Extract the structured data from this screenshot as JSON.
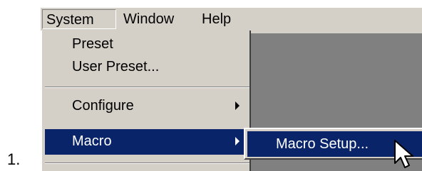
{
  "step": {
    "number": "1."
  },
  "menubar": {
    "items": [
      {
        "label": "System"
      },
      {
        "label": "Window"
      },
      {
        "label": "Help"
      }
    ]
  },
  "system_menu": {
    "items": [
      {
        "label": "Preset"
      },
      {
        "label": "User Preset..."
      },
      {
        "label": "Configure",
        "has_submenu": true
      },
      {
        "label": "Macro",
        "has_submenu": true,
        "highlighted": true
      }
    ]
  },
  "macro_submenu": {
    "items": [
      {
        "label": "Macro Setup...",
        "highlighted": true
      }
    ]
  },
  "colors": {
    "menu_bg": "#d4d0c8",
    "highlight": "#0a246a",
    "workspace": "#808080"
  },
  "icons": {
    "cursor": "arrow-cursor-icon",
    "submenu": "submenu-arrow-icon"
  }
}
